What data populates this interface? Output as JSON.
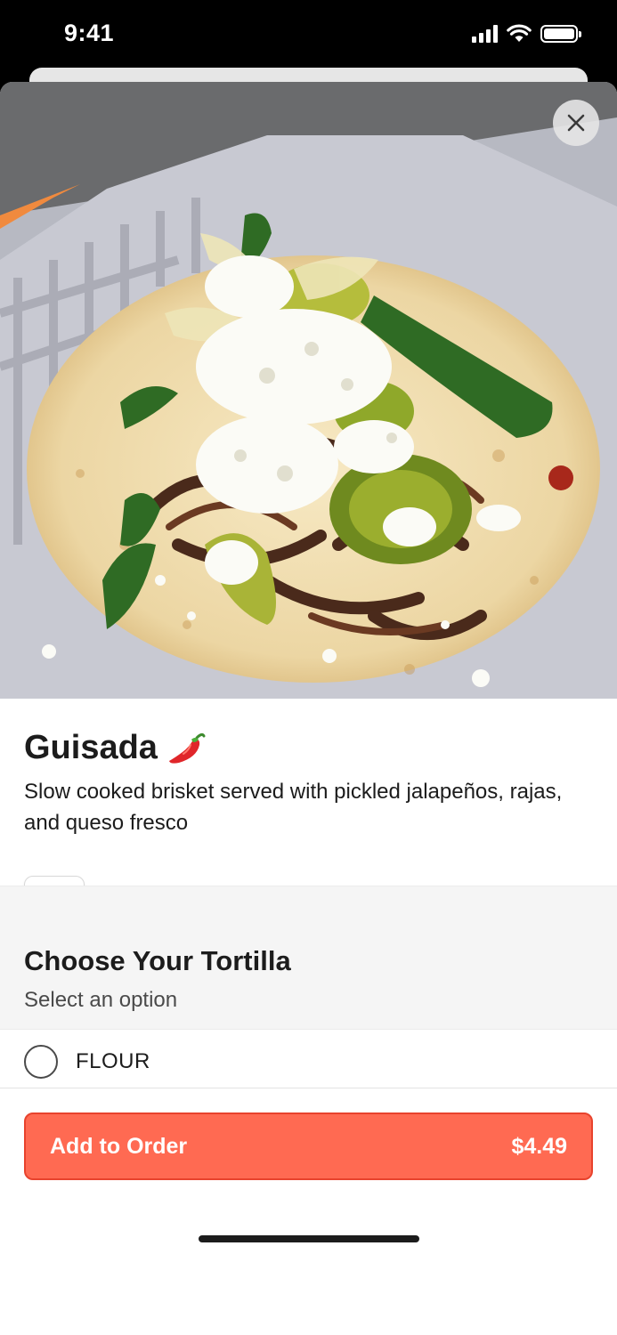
{
  "status_bar": {
    "time": "9:41"
  },
  "item": {
    "title": "Guisada",
    "description": "Slow cooked brisket served with pickled jalapeños, rajas, and queso fresco",
    "image": "guisada-taco-photo"
  },
  "option_group": {
    "title": "Choose Your Tortilla",
    "subtitle": "Select an option",
    "options": [
      {
        "label": "FLOUR",
        "selected": false
      }
    ]
  },
  "order": {
    "button_label": "Add to Order",
    "price": "$4.49"
  },
  "icons": {
    "close": "close-icon",
    "favorite": "heart-icon",
    "spicy": "chili-pepper-icon"
  },
  "colors": {
    "accent": "#ff6a52",
    "accent_border": "#e8432d"
  }
}
